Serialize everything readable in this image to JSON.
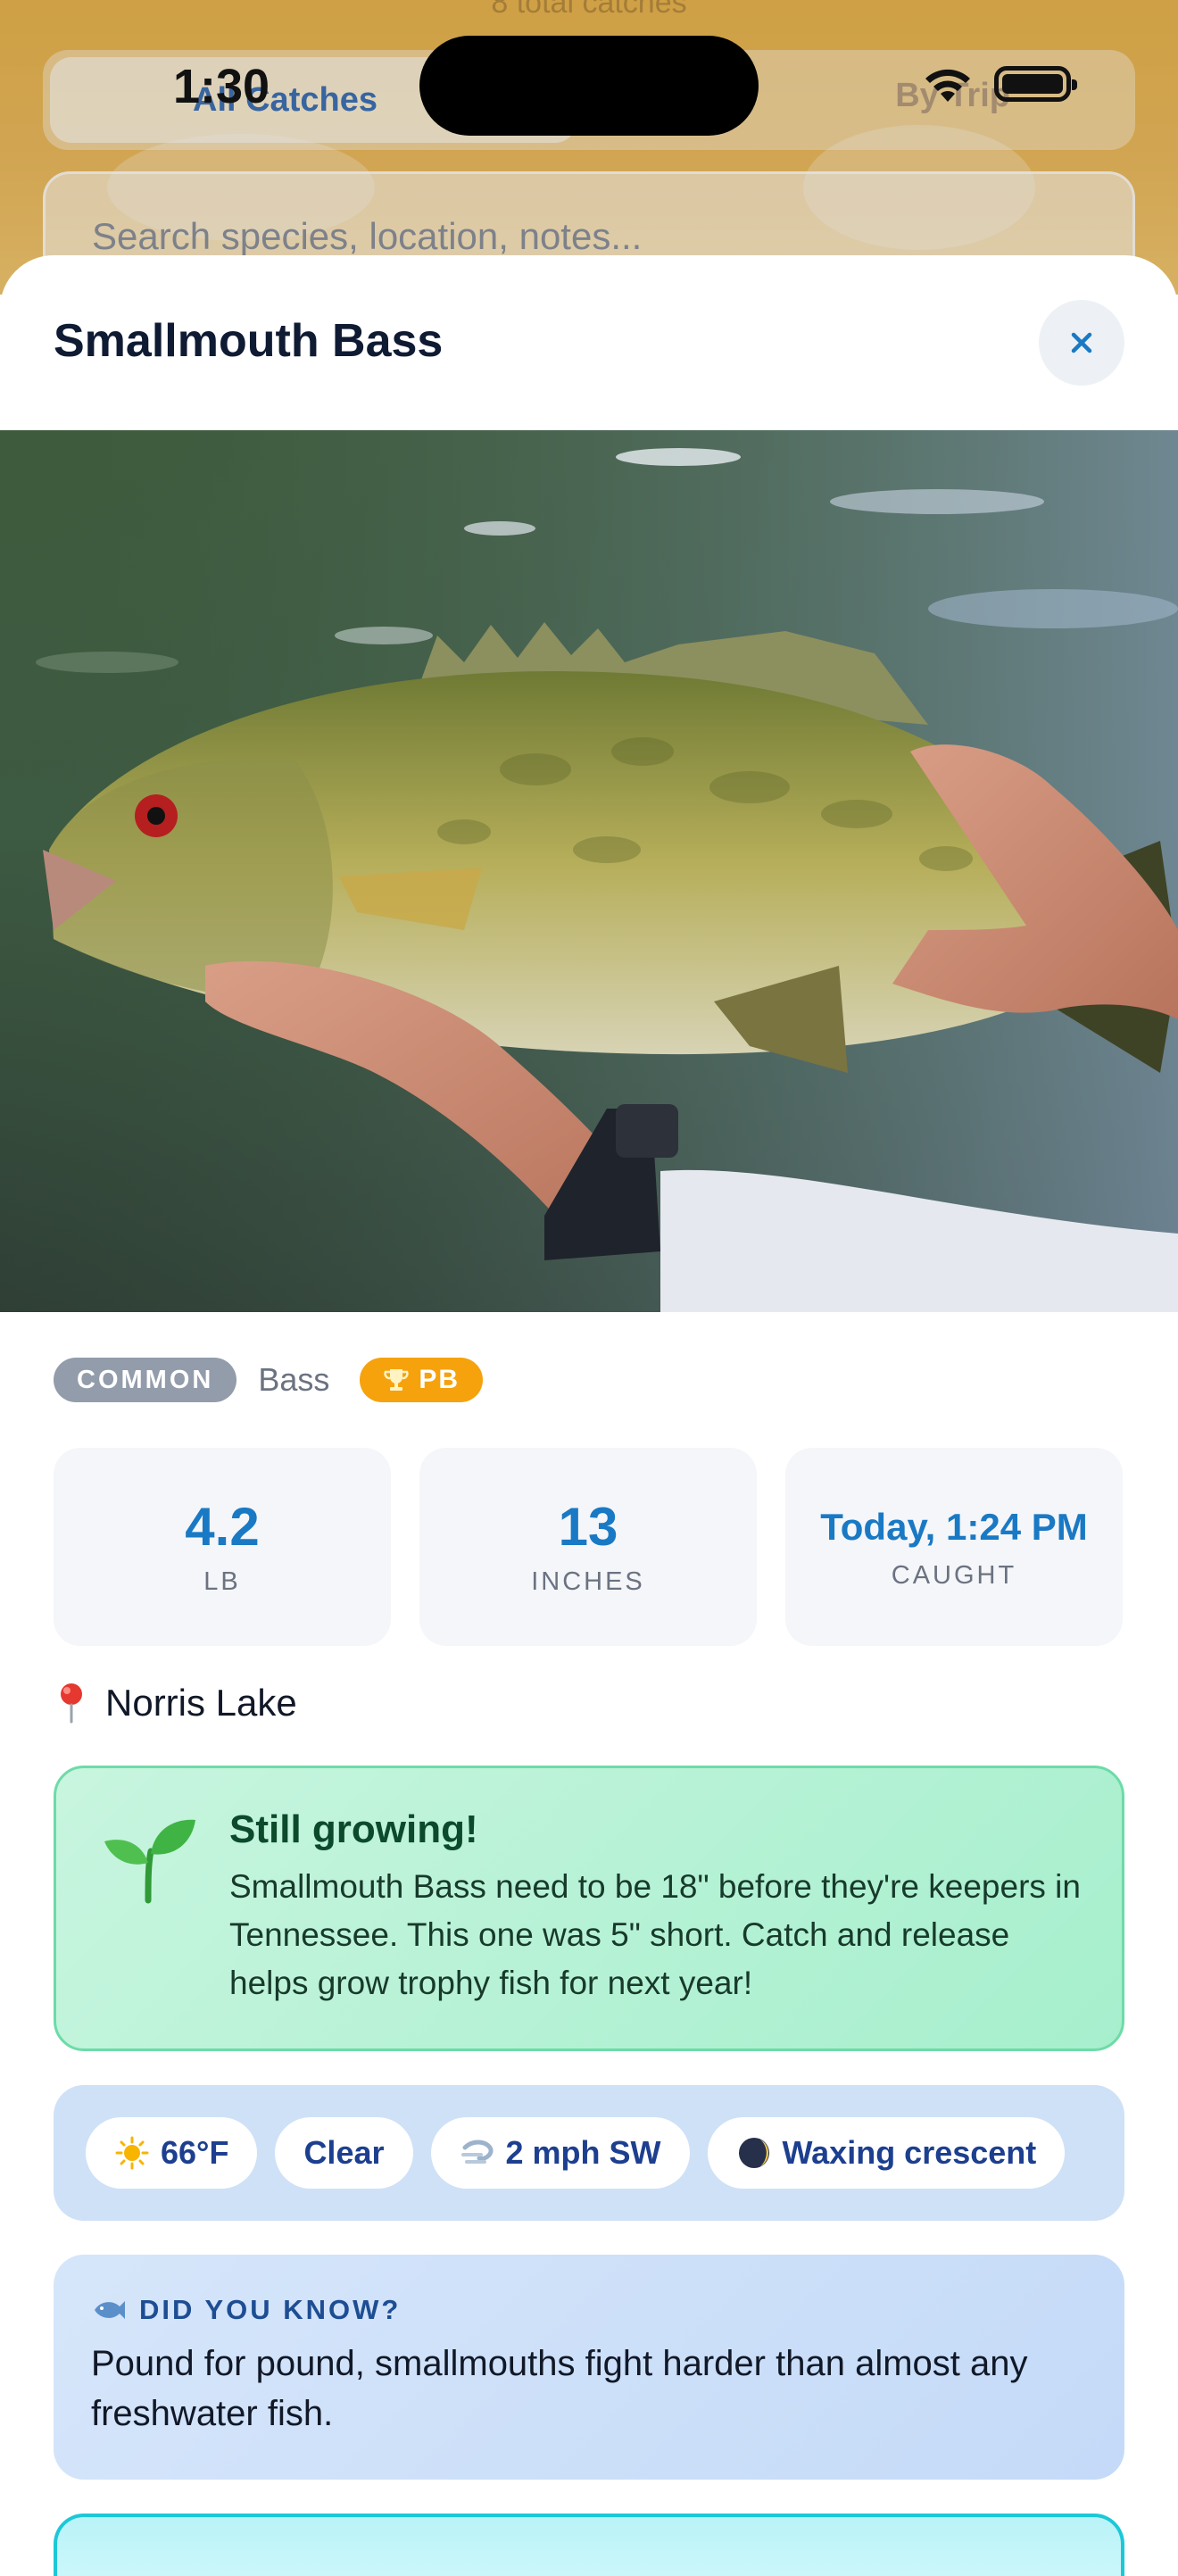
{
  "status_bar": {
    "time": "1:30"
  },
  "background": {
    "count_text": "8 total catches",
    "tab_all": "All Catches",
    "tab_trip": "By Trip",
    "search_placeholder": "Search species, location, notes..."
  },
  "sheet": {
    "title": "Smallmouth Bass",
    "photo_alt": "Smallmouth bass held over water",
    "rarity_badge": "COMMON",
    "family": "Bass",
    "pb_badge": "PB",
    "stats": [
      {
        "value": "4.2",
        "label": "LB"
      },
      {
        "value": "13",
        "label": "INCHES"
      },
      {
        "value": "Today, 1:24 PM",
        "label": "CAUGHT"
      }
    ],
    "location": "Norris Lake",
    "growing": {
      "title": "Still growing!",
      "body": "Smallmouth Bass need to be 18\" before they're keepers in Tennessee. This one was 5\" short. Catch and release helps grow trophy fish for next year!"
    },
    "conditions": {
      "temperature": "66°F",
      "sky": "Clear",
      "wind": "2 mph SW",
      "moon": "Waxing crescent"
    },
    "fact": {
      "label": "DID YOU KNOW?",
      "text": "Pound for pound, smallmouths fight harder than almost any freshwater fish."
    }
  },
  "colors": {
    "accent_blue": "#1a79c4",
    "pb_orange": "#f5a20d",
    "growing_green": "#a6efcd",
    "conditions_blue": "#cfe1f7"
  }
}
